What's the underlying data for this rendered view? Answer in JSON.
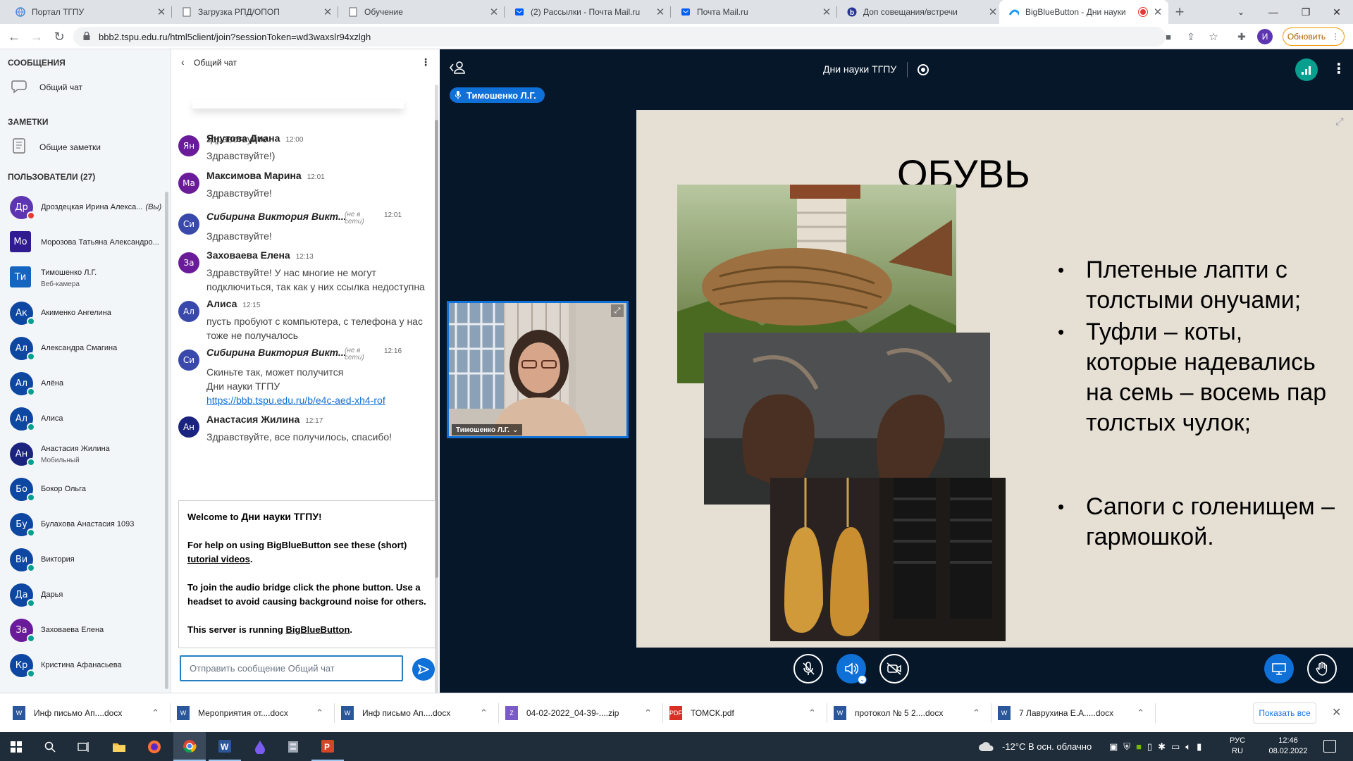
{
  "browser": {
    "tabs": [
      {
        "title": "Портал ТГПУ",
        "icon": "globe-icon"
      },
      {
        "title": "Загрузка РПД/ОПОП",
        "icon": "document-icon"
      },
      {
        "title": "Обучение",
        "icon": "document-icon"
      },
      {
        "title": "(2) Рассылки - Почта Mail.ru",
        "icon": "mail-icon"
      },
      {
        "title": "Почта Mail.ru",
        "icon": "mail-icon"
      },
      {
        "title": "Доп совещания/встречи",
        "icon": "b-icon"
      },
      {
        "title": "BigBlueButton - Дни науки",
        "icon": "bbb-icon",
        "active": true
      }
    ],
    "url": "bbb2.tspu.edu.ru/html5client/join?sessionToken=wd3waxslr94xzlgh",
    "profile_initial": "И",
    "update_label": "Обновить"
  },
  "sidebar": {
    "messages_title": "СООБЩЕНИЯ",
    "public_chat": "Общий чат",
    "notes_title": "ЗАМЕТКИ",
    "shared_notes": "Общие заметки",
    "users_title": "ПОЛЬЗОВАТЕЛИ (27)",
    "users": [
      {
        "initials": "Др",
        "name": "Дроздецкая Ирина Алекса...",
        "suffix": "(Вы)",
        "color": "#5e35b1",
        "status": "muted"
      },
      {
        "initials": "Мо",
        "name": "Морозова Татьяна Александро...",
        "color": "#311b92",
        "square": true
      },
      {
        "initials": "Ти",
        "name": "Тимошенко Л.Г.",
        "sub": "Веб-камера",
        "color": "#1565c0",
        "square": true
      },
      {
        "initials": "Ак",
        "name": "Акименко Ангелина",
        "color": "#0d47a1",
        "status": "online"
      },
      {
        "initials": "Ал",
        "name": "Александра Смагина",
        "color": "#0d47a1",
        "status": "online"
      },
      {
        "initials": "Ал",
        "name": "Алёна",
        "color": "#0d47a1",
        "status": "online"
      },
      {
        "initials": "Ал",
        "name": "Алиса",
        "color": "#0d47a1",
        "status": "online"
      },
      {
        "initials": "Ан",
        "name": "Анастасия Жилина",
        "sub": "Мобильный",
        "color": "#1a237e",
        "status": "online"
      },
      {
        "initials": "Бо",
        "name": "Бокор Ольга",
        "color": "#0d47a1",
        "status": "online"
      },
      {
        "initials": "Бу",
        "name": "Булахова Анастасия 1093",
        "color": "#0d47a1",
        "status": "online"
      },
      {
        "initials": "Ви",
        "name": "Виктория",
        "color": "#0d47a1",
        "status": "online"
      },
      {
        "initials": "Да",
        "name": "Дарья",
        "color": "#0d47a1",
        "status": "online"
      },
      {
        "initials": "За",
        "name": "Заховаева Елена",
        "color": "#6a1b9a",
        "status": "online"
      },
      {
        "initials": "Кр",
        "name": "Кристина Афанасьева",
        "color": "#0d47a1",
        "status": "online"
      }
    ]
  },
  "chat": {
    "header": "Общий чат",
    "top_partial": "здравствуйте",
    "messages": [
      {
        "initials": "Ян",
        "name": "Янутова Диана",
        "time": "12:00",
        "lines": [
          "Здравствуйте!)"
        ],
        "color": "#6a1b9a"
      },
      {
        "initials": "Ма",
        "name": "Максимова Марина",
        "time": "12:01",
        "lines": [
          "Здравствуйте!"
        ],
        "color": "#6a1b9a"
      },
      {
        "initials": "Си",
        "name": "Сибирина Виктория Викт...",
        "time": "12:01",
        "offline": "(не в сети)",
        "lines": [
          "Здравствуйте!"
        ],
        "color": "#3949ab"
      },
      {
        "initials": "За",
        "name": "Заховаева Елена",
        "time": "12:13",
        "lines": [
          "Здравствуйте! У нас многие не могут",
          "подключиться, так как у них ссылка недоступна"
        ],
        "color": "#6a1b9a"
      },
      {
        "initials": "Ал",
        "name": "Алиса",
        "time": "12:15",
        "lines": [
          "пусть пробуют с компьютера, с телефона у нас",
          "тоже не получалось"
        ],
        "color": "#3949ab"
      },
      {
        "initials": "Си",
        "name": "Сибирина Виктория Викт...",
        "time": "12:16",
        "offline": "(не в сети)",
        "lines": [
          "Скиньте так, может получится",
          "Дни науки ТГПУ"
        ],
        "link": "https://bbb.tspu.edu.ru/b/e4c-aed-xh4-rof",
        "color": "#3949ab"
      },
      {
        "initials": "Ан",
        "name": "Анастасия Жилина",
        "time": "12:17",
        "lines": [
          "Здравствуйте, все получилось, спасибо!"
        ],
        "color": "#1a237e"
      }
    ],
    "welcome": {
      "line1_pre": "Welcome to ",
      "line1_name": "Дни науки ТГПУ",
      "line1_post": "!",
      "help_pre": "For help on using BigBlueButton see these (short) ",
      "help_link": "tutorial videos",
      "help_post": ".",
      "audio": "To join the audio bridge click the phone button. Use a headset to avoid causing background noise for others.",
      "server_pre": "This server is running ",
      "server_link": "BigBlueButton",
      "server_post": "."
    },
    "input_placeholder": "Отправить сообщение Общий чат"
  },
  "main": {
    "meeting_title": "Дни науки ТГПУ",
    "talker": "Тимошенко Л.Г.",
    "webcam_label": "Тимошенко Л.Г.",
    "slide": {
      "title": "ОБУВЬ",
      "bullets": [
        "Плетеные лапти с толстыми онучами;",
        "Туфли – коты, которые надевались на семь – восемь пар толстых чулок;",
        "Сапоги с голенищем – гармошкой."
      ]
    }
  },
  "downloads": {
    "items": [
      {
        "name": "Инф письмо Ап....docx",
        "icon": "word-icon"
      },
      {
        "name": "Мероприятия от....docx",
        "icon": "word-icon"
      },
      {
        "name": "Инф письмо Ап....docx",
        "icon": "word-icon"
      },
      {
        "name": "04-02-2022_04-39-....zip",
        "icon": "zip-icon"
      },
      {
        "name": "ТОМСК.pdf",
        "icon": "pdf-icon"
      },
      {
        "name": "протокол № 5 2....docx",
        "icon": "word-icon"
      },
      {
        "name": "7 Лаврухина Е.А.....docx",
        "icon": "word-icon"
      }
    ],
    "show_all": "Показать все"
  },
  "taskbar": {
    "weather": "-12°C  В осн. облачно",
    "lang_top": "РУС",
    "lang_bottom": "RU",
    "time": "12:46",
    "date": "08.02.2022"
  }
}
